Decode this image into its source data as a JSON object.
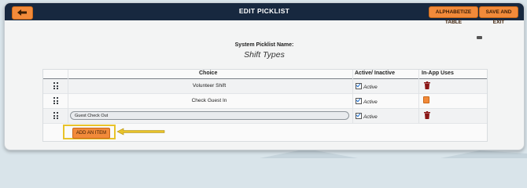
{
  "header": {
    "title": "EDIT PICKLIST",
    "alphabetize_label": "ALPHABETIZE TABLE",
    "save_exit_label": "SAVE AND EXIT"
  },
  "picklist": {
    "system_name_label": "System Picklist Name:",
    "system_name": "Shift Types"
  },
  "table": {
    "columns": {
      "choice": "Choice",
      "active": "Active/ Inactive",
      "uses": "In-App Uses"
    },
    "rows": [
      {
        "choice": "Volunteer Shift",
        "active_label": "Active",
        "uses_icon": "trash-icon"
      },
      {
        "choice": "Check Guest In",
        "active_label": "Active",
        "uses_icon": "in-use-badge-icon"
      },
      {
        "choice": "Guest Check Out",
        "active_label": "Active",
        "uses_icon": "trash-icon"
      }
    ],
    "add_item_label": "ADD AN ITEM"
  },
  "colors": {
    "header_bg": "#17283f",
    "accent": "#f28a3a",
    "highlight": "#e8c32a",
    "trash": "#8a1414"
  }
}
